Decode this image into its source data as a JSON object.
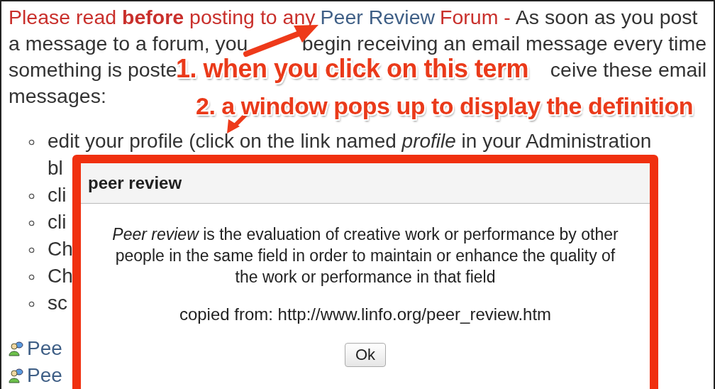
{
  "intro_lines": [
    [
      {
        "kind": "alert",
        "text": "Please read **before** posting to any"
      },
      {
        "kind": "link",
        "text": "Peer Review"
      },
      {
        "kind": "alert",
        "text": "Forum -"
      },
      {
        "kind": "plain",
        "text": "As soon as you post"
      }
    ],
    [
      {
        "kind": "plain",
        "text": "a message to a forum, you"
      },
      {
        "kind": "plain",
        "text": "begin receiving an email message every time"
      }
    ],
    [
      {
        "kind": "plain",
        "text": "something is poste"
      },
      {
        "kind": "plain",
        "text": "ceive these email"
      }
    ],
    [
      {
        "kind": "plain",
        "text": "messages:"
      }
    ]
  ],
  "list_items": [
    "edit your profile (click on the link named *profile* in your Administration bl",
    "cli",
    "cli",
    "Ch",
    "Ch",
    "sc"
  ],
  "forum_links": [
    "Pee",
    "Pee"
  ],
  "callouts": [
    "1. when you click on this term",
    "2. a window pops up to display the definition"
  ],
  "dialog": {
    "title": "peer review",
    "definition": "*Peer review* is the evaluation of creative work or performance by other people in the same field in order to maintain or enhance the quality of the work or performance in that field",
    "source": "copied from: http://www.linfo.org/peer_review.htm",
    "button": "Ok"
  }
}
